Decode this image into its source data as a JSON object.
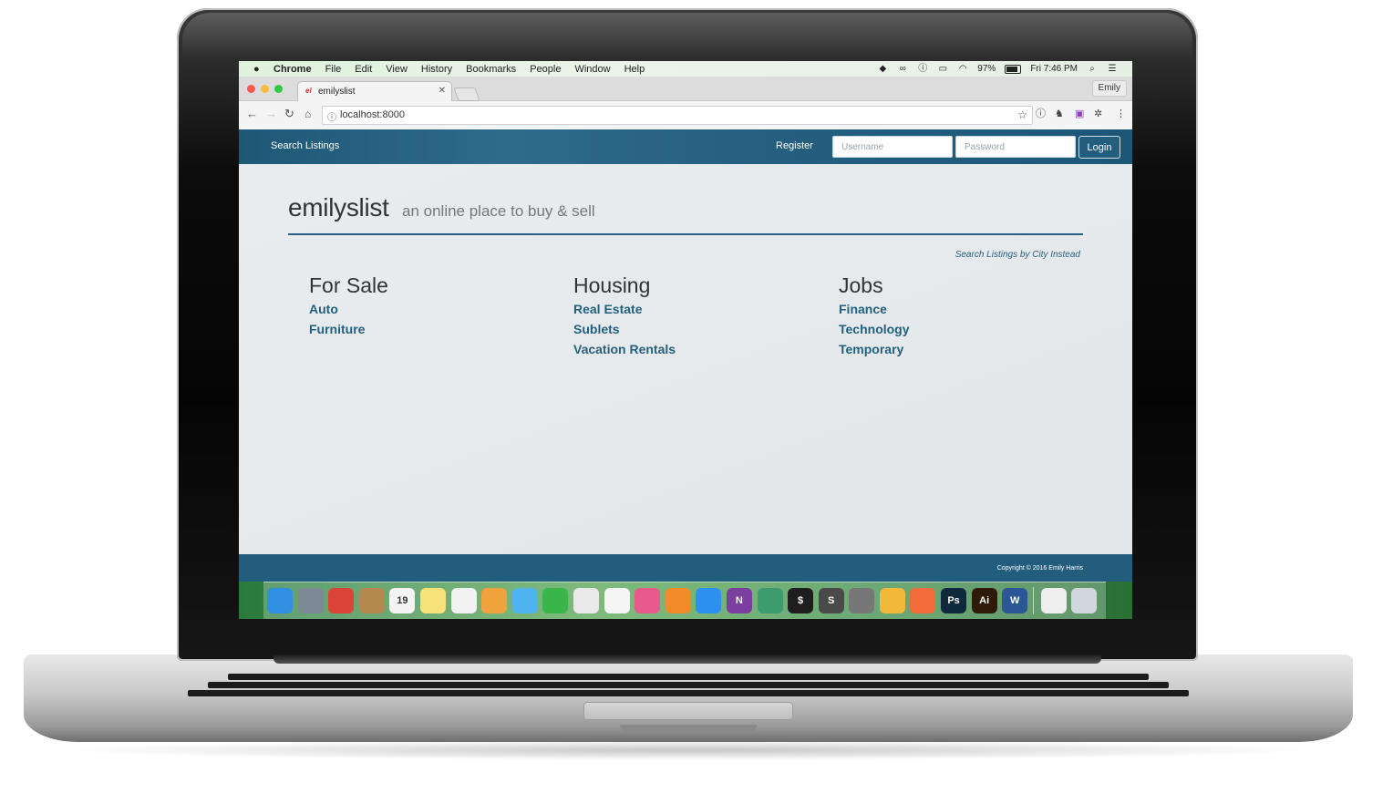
{
  "menubar": {
    "items": [
      "Chrome",
      "File",
      "Edit",
      "View",
      "History",
      "Bookmarks",
      "People",
      "Window",
      "Help"
    ],
    "battery": "97%",
    "clock": "Fri 7:46 PM"
  },
  "browser": {
    "tab_title": "emilyslist",
    "tab_favicon": "el",
    "profile": "Emily",
    "url": "localhost:8000"
  },
  "site": {
    "nav": {
      "brand": "Search Listings",
      "register": "Register",
      "username_placeholder": "Username",
      "password_placeholder": "Password",
      "login": "Login"
    },
    "title": "emilyslist",
    "tagline": "an online place to buy & sell",
    "city_link": "Search Listings by City Instead",
    "categories": [
      {
        "heading": "For Sale",
        "links": [
          "Auto",
          "Furniture"
        ]
      },
      {
        "heading": "Housing",
        "links": [
          "Real Estate",
          "Sublets",
          "Vacation Rentals"
        ]
      },
      {
        "heading": "Jobs",
        "links": [
          "Finance",
          "Technology",
          "Temporary"
        ]
      }
    ],
    "footer": "Copyright © 2016 Emily Harris"
  },
  "dock": {
    "apps": [
      {
        "name": "finder",
        "color": "#2f8fe0",
        "glyph": ""
      },
      {
        "name": "launchpad",
        "color": "#7d8a95",
        "glyph": ""
      },
      {
        "name": "chrome",
        "color": "#db4437",
        "glyph": ""
      },
      {
        "name": "contacts",
        "color": "#b5884f",
        "glyph": ""
      },
      {
        "name": "calendar",
        "color": "#f4f4f4",
        "glyph": "19"
      },
      {
        "name": "notes",
        "color": "#f7e27a",
        "glyph": ""
      },
      {
        "name": "reminders",
        "color": "#f2f2f2",
        "glyph": ""
      },
      {
        "name": "photos",
        "color": "#f0a23c",
        "glyph": ""
      },
      {
        "name": "messages",
        "color": "#4fb3f0",
        "glyph": ""
      },
      {
        "name": "facetime",
        "color": "#39b54a",
        "glyph": ""
      },
      {
        "name": "keynote",
        "color": "#e9e9e9",
        "glyph": ""
      },
      {
        "name": "numbers",
        "color": "#f5f5f5",
        "glyph": ""
      },
      {
        "name": "itunes",
        "color": "#e85a8b",
        "glyph": ""
      },
      {
        "name": "ibooks",
        "color": "#f28c28",
        "glyph": ""
      },
      {
        "name": "app-store",
        "color": "#2d8ff0",
        "glyph": ""
      },
      {
        "name": "onenote",
        "color": "#7b3fa0",
        "glyph": "N"
      },
      {
        "name": "atom",
        "color": "#3d9b6e",
        "glyph": ""
      },
      {
        "name": "terminal",
        "color": "#1e1e1e",
        "glyph": "$"
      },
      {
        "name": "sublime-text",
        "color": "#4a4a4a",
        "glyph": "S"
      },
      {
        "name": "system-preferences",
        "color": "#777777",
        "glyph": ""
      },
      {
        "name": "cup-app",
        "color": "#f1b83a",
        "glyph": ""
      },
      {
        "name": "postman",
        "color": "#f26b3a",
        "glyph": ""
      },
      {
        "name": "photoshop",
        "color": "#0f2a3d",
        "glyph": "Ps"
      },
      {
        "name": "illustrator",
        "color": "#2e1a07",
        "glyph": "Ai"
      },
      {
        "name": "word",
        "color": "#2b5797",
        "glyph": "W"
      }
    ],
    "trailing": [
      {
        "name": "downloads-stack",
        "color": "#eeeeee",
        "glyph": ""
      },
      {
        "name": "trash",
        "color": "#cfd8dc",
        "glyph": ""
      }
    ]
  }
}
